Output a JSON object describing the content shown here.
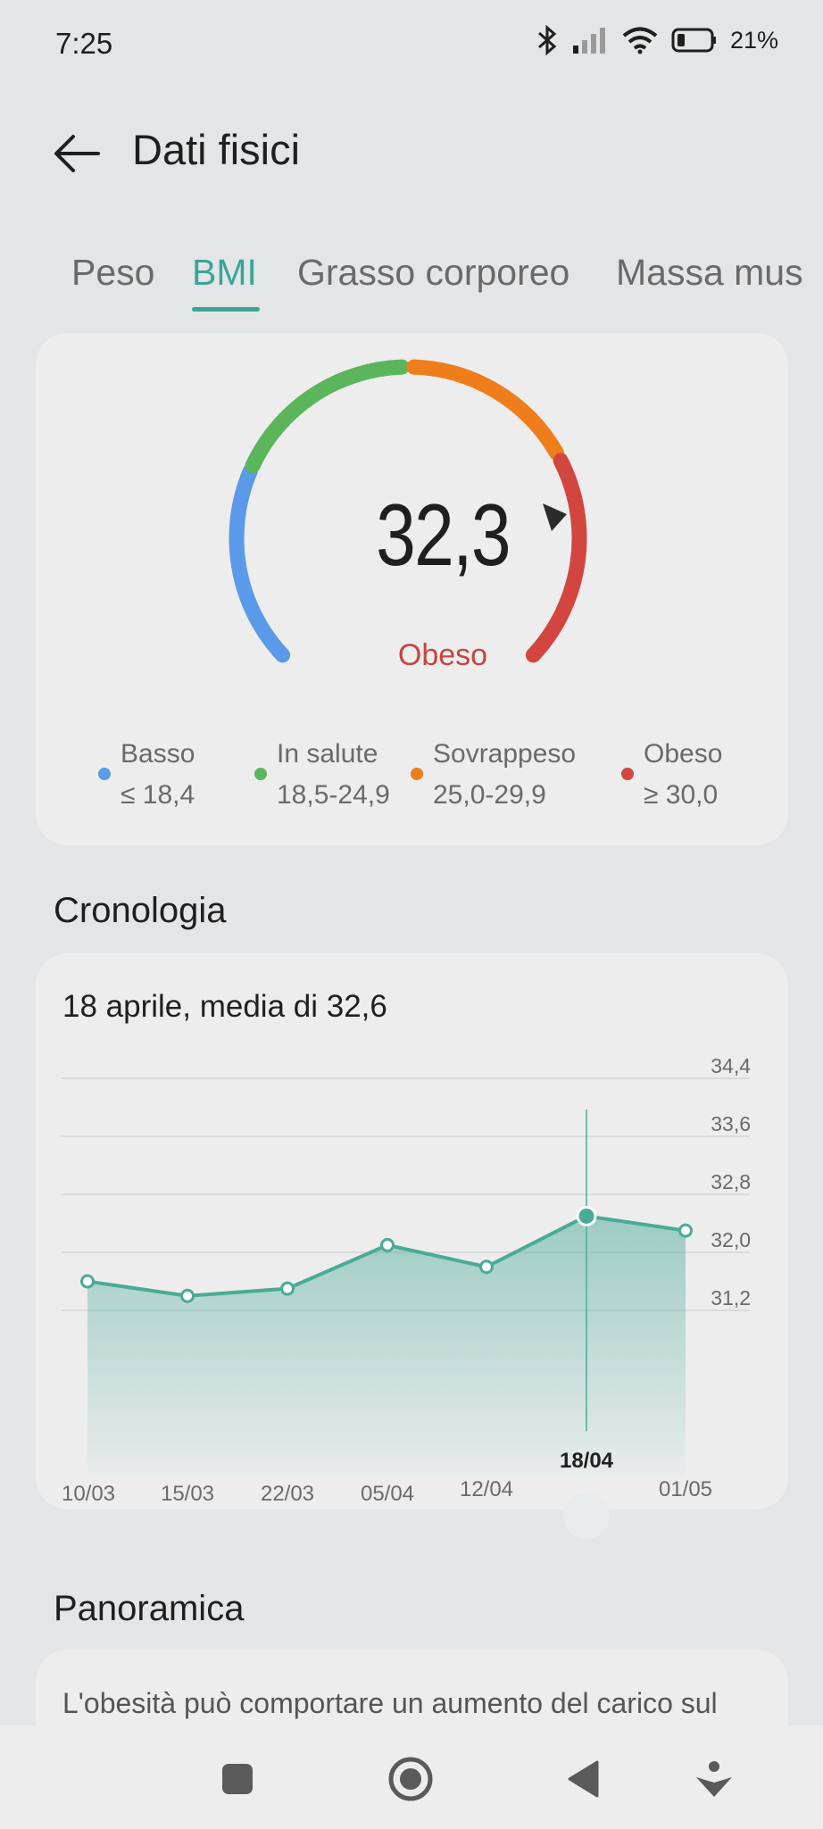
{
  "status_bar": {
    "time": "7:25",
    "battery": "21%"
  },
  "header": {
    "title": "Dati fisici"
  },
  "tabs": [
    {
      "label": "Peso",
      "active": false
    },
    {
      "label": "BMI",
      "active": true
    },
    {
      "label": "Grasso corporeo",
      "active": false
    },
    {
      "label": "Massa mus",
      "active": false
    }
  ],
  "gauge": {
    "value": "32,3",
    "status": "Obeso",
    "legend": [
      {
        "label": "Basso",
        "range": "≤ 18,4",
        "color": "#5b9ae9"
      },
      {
        "label": "In salute",
        "range": "18,5-24,9",
        "color": "#5bb55b"
      },
      {
        "label": "Sovrappeso",
        "range": "25,0-29,9",
        "color": "#ef7d1c"
      },
      {
        "label": "Obeso",
        "range": "≥ 30,0",
        "color": "#d2463f"
      }
    ]
  },
  "history": {
    "title": "Cronologia",
    "heading": "18 aprile, media di 32,6"
  },
  "chart_data": {
    "type": "area",
    "x": [
      "10/03",
      "15/03",
      "22/03",
      "05/04",
      "12/04",
      "18/04",
      "01/05"
    ],
    "values": [
      31.6,
      31.4,
      31.5,
      32.1,
      31.8,
      32.5,
      32.3
    ],
    "selected": "18/04",
    "yticks": [
      "34,4",
      "33,6",
      "32,8",
      "32,0",
      "31,2"
    ],
    "ylim": [
      30.4,
      34.4
    ],
    "color": "#4aab96"
  },
  "overview": {
    "title": "Panoramica",
    "text": "L'obesità può comportare un aumento del carico sul"
  },
  "nav": {
    "recent_icon": "square-icon",
    "home_icon": "circle-icon",
    "back_icon": "triangle-back-icon",
    "assist_icon": "assistant-icon"
  }
}
